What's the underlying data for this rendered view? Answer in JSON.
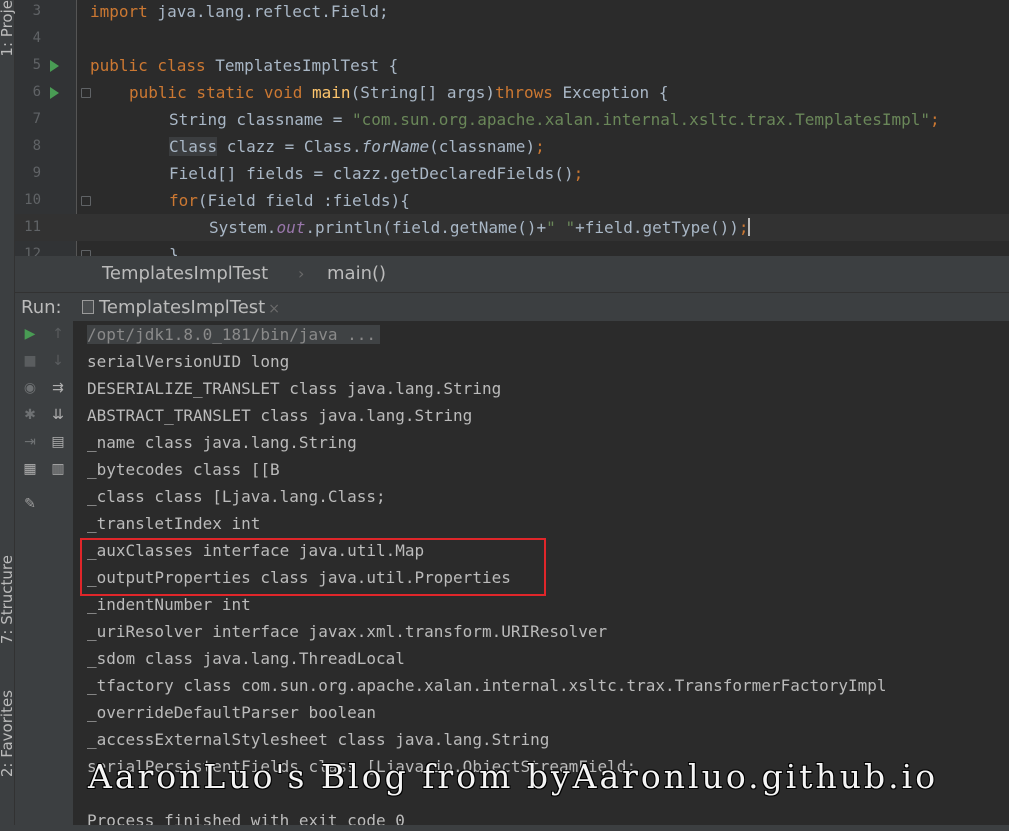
{
  "sidebar": {
    "tabs": [
      {
        "label": "1: Proje"
      },
      {
        "label": "7: Structure"
      },
      {
        "label": "2: Favorites"
      }
    ]
  },
  "editor": {
    "lines": [
      {
        "number": "3",
        "run_icon": false,
        "fold": false,
        "current": false
      },
      {
        "number": "4",
        "run_icon": false,
        "fold": false,
        "current": false
      },
      {
        "number": "5",
        "run_icon": true,
        "fold": false,
        "current": false
      },
      {
        "number": "6",
        "run_icon": true,
        "fold": true,
        "current": false
      },
      {
        "number": "7",
        "run_icon": false,
        "fold": false,
        "current": false
      },
      {
        "number": "8",
        "run_icon": false,
        "fold": false,
        "current": false
      },
      {
        "number": "9",
        "run_icon": false,
        "fold": false,
        "current": false
      },
      {
        "number": "10",
        "run_icon": false,
        "fold": true,
        "current": false
      },
      {
        "number": "11",
        "run_icon": false,
        "fold": false,
        "current": true
      },
      {
        "number": "12",
        "run_icon": false,
        "fold": true,
        "current": false
      }
    ],
    "tokens": {
      "l3_kw": "import",
      "l3_rest": " java.lang.reflect.Field;",
      "l5_kw": "public class",
      "l5_rest": " TemplatesImplTest {",
      "l6_kw": "public static void",
      "l6_fn": "main",
      "l6_args": "(String[] args)",
      "l6_throws": "throws",
      "l6_rest": " Exception {",
      "l7_pre": "String classname = ",
      "l7_str": "\"com.sun.org.apache.xalan.internal.xsltc.trax.TemplatesImpl\"",
      "l7_semi": ";",
      "l8_class": "Class",
      "l8_mid": " clazz = Class.",
      "l8_fn": "forName",
      "l8_rest": "(classname)",
      "l8_semi": ";",
      "l9_pre": "Field[] fields = clazz.getDeclaredFields()",
      "l9_semi": ";",
      "l10_kw": "for",
      "l10_rest": "(Field field :fields){",
      "l11_pre": "System.",
      "l11_out": "out",
      "l11_mid": ".println(field.getName()+",
      "l11_str": "\" \"",
      "l11_rest": "+field.getType())",
      "l11_semi": ";",
      "l12_brace": "}"
    }
  },
  "breadcrumb": {
    "class_name": "TemplatesImplTest",
    "separator": "›",
    "method": "main()"
  },
  "run_panel": {
    "label": "Run:",
    "tab_title": "TemplatesImplTest",
    "close_glyph": "×",
    "tools": [
      {
        "name": "rerun-icon",
        "glyph": "▶"
      },
      {
        "name": "scroll-up-icon",
        "glyph": "↑"
      },
      {
        "name": "stop-icon",
        "glyph": "■"
      },
      {
        "name": "scroll-down-icon",
        "glyph": "↓"
      },
      {
        "name": "camera-icon",
        "glyph": "◉"
      },
      {
        "name": "soft-wrap-icon",
        "glyph": "⇉"
      },
      {
        "name": "debug-icon",
        "glyph": "✱"
      },
      {
        "name": "scroll-to-end-icon",
        "glyph": "⇊"
      },
      {
        "name": "exit-icon",
        "glyph": "⇥"
      },
      {
        "name": "print-icon",
        "glyph": "▤"
      },
      {
        "name": "layout-icon",
        "glyph": "▦"
      },
      {
        "name": "trash-icon",
        "glyph": "▥"
      },
      {
        "name": "pin-icon",
        "glyph": "✎"
      }
    ],
    "output": [
      "/opt/jdk1.8.0_181/bin/java ...",
      "serialVersionUID long",
      "DESERIALIZE_TRANSLET class java.lang.String",
      "ABSTRACT_TRANSLET class java.lang.String",
      "_name class java.lang.String",
      "_bytecodes class [[B",
      "_class class [Ljava.lang.Class;",
      "_transletIndex int",
      "_auxClasses interface java.util.Map",
      "_outputProperties class java.util.Properties",
      "_indentNumber int",
      "_uriResolver interface javax.xml.transform.URIResolver",
      "_sdom class java.lang.ThreadLocal",
      "_tfactory class com.sun.org.apache.xalan.internal.xsltc.trax.TransformerFactoryImpl",
      "_overrideDefaultParser boolean",
      "_accessExternalStylesheet class java.lang.String",
      "serialPersistentFields class [Ljava.io.ObjectStreamField;",
      "",
      "Process finished with exit code 0"
    ]
  },
  "watermark": "AaronLuo's Blog from byAaronluo.github.io",
  "colors": {
    "background": "#2b2b2b",
    "keyword": "#cc7832",
    "string": "#6a8759",
    "function": "#ffc66d",
    "field": "#9876aa",
    "highlight_box": "#e0262a",
    "run_green": "#499c54"
  }
}
